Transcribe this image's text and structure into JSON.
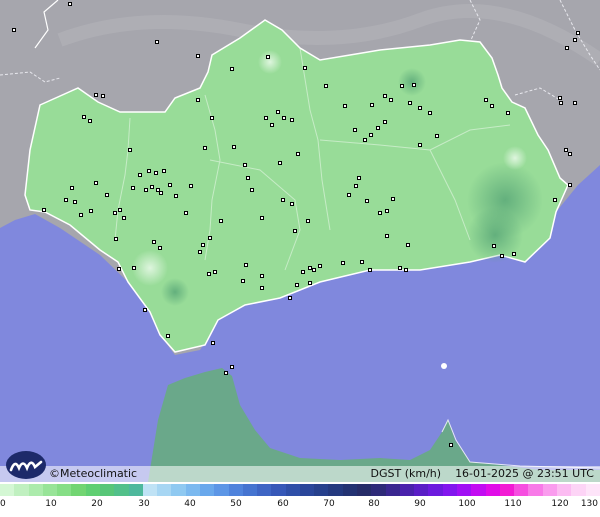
{
  "map": {
    "brand": "Meteoclimatic",
    "variable_label": "DGST (km/h)",
    "timestamp": "16-01-2025 @ 23:51 UTC",
    "colors": {
      "sea": "#8088dd",
      "land_outside": "#a6a6ad",
      "region_fill": "#98dc98",
      "region_border": "#ffffff",
      "morocco_fill": "#6aa88a"
    }
  },
  "legend": {
    "ticks": [
      "0",
      "10",
      "20",
      "30",
      "40",
      "50",
      "60",
      "70",
      "80",
      "90",
      "100",
      "110",
      "120",
      "130"
    ],
    "scale_colors": [
      "#d4f7d4",
      "#c0f0c0",
      "#acebac",
      "#98e498",
      "#86de86",
      "#72d572",
      "#60cf72",
      "#58c678",
      "#52c08a",
      "#4eb89c",
      "#bfe2f5",
      "#a7d6f3",
      "#8fc9f1",
      "#7bb9ef",
      "#69a8ec",
      "#5c96e6",
      "#4f83dc",
      "#4574d0",
      "#3e65c4",
      "#3658b8",
      "#2f4fa8",
      "#2a469a",
      "#26408c",
      "#24397f",
      "#233272",
      "#262c68",
      "#2e2a78",
      "#3a2790",
      "#4a22ac",
      "#5a1ec6",
      "#6c1ade",
      "#8216ee",
      "#a010f4",
      "#c20cf2",
      "#e00ce8",
      "#f21cd4",
      "#f64ee0",
      "#f87ae8",
      "#fa9cee",
      "#fcbcf2",
      "#fdd4f6",
      "#fee4f9"
    ]
  }
}
